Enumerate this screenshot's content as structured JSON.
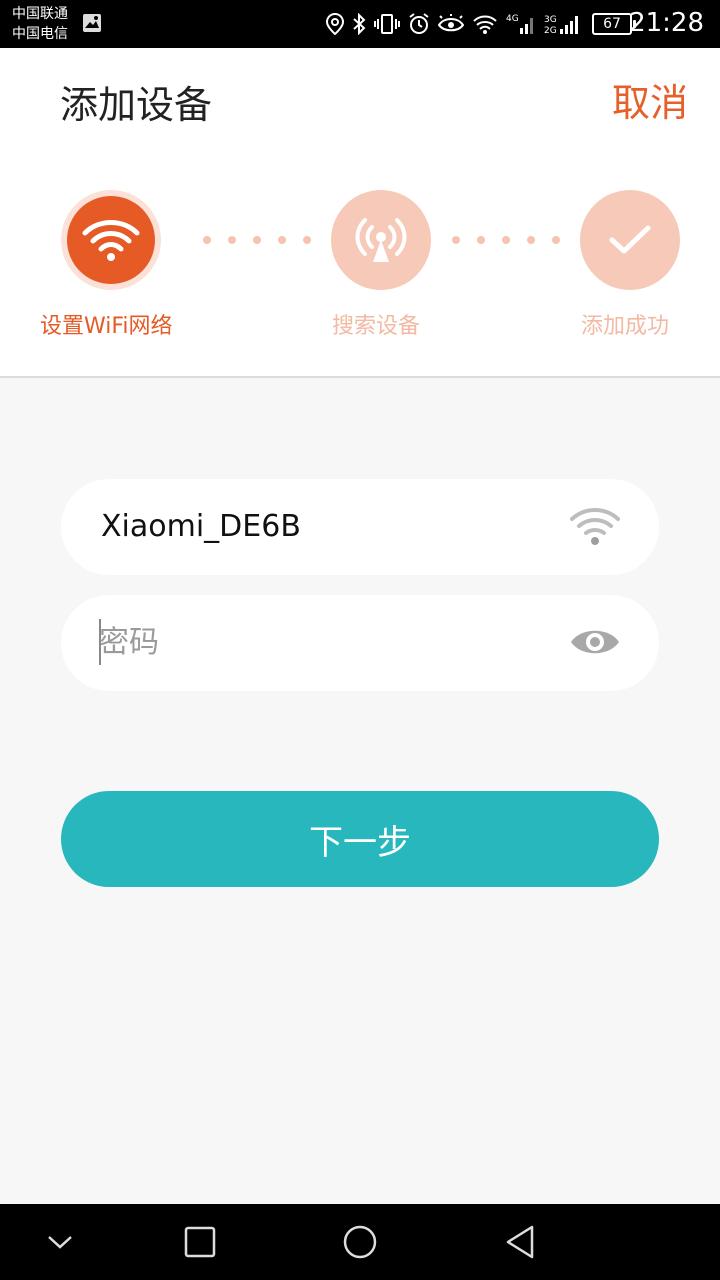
{
  "status_bar": {
    "carrier_1": "中国联通",
    "carrier_2": "中国电信",
    "battery": "67",
    "time": "21:28",
    "icons": [
      "location-icon",
      "bluetooth-icon",
      "vibrate-icon",
      "alarm-icon",
      "eye-comfort-icon",
      "wifi-icon",
      "signal-4g-icon",
      "signal-3g-2g-icon",
      "battery-icon"
    ]
  },
  "header": {
    "title": "添加设备",
    "cancel_label": "取消"
  },
  "steps": [
    {
      "label": "设置WiFi网络",
      "icon": "wifi-icon",
      "state": "active"
    },
    {
      "label": "搜索设备",
      "icon": "broadcast-icon",
      "state": "pending"
    },
    {
      "label": "添加成功",
      "icon": "checkmark-icon",
      "state": "pending"
    }
  ],
  "form": {
    "ssid": "Xiaomi_DE6B",
    "password_placeholder": "密码",
    "password_value": ""
  },
  "next_label": "下一步",
  "colors": {
    "accent": "#e55a25",
    "accent_faded": "#f7c9b9",
    "button": "#27b7bd"
  }
}
